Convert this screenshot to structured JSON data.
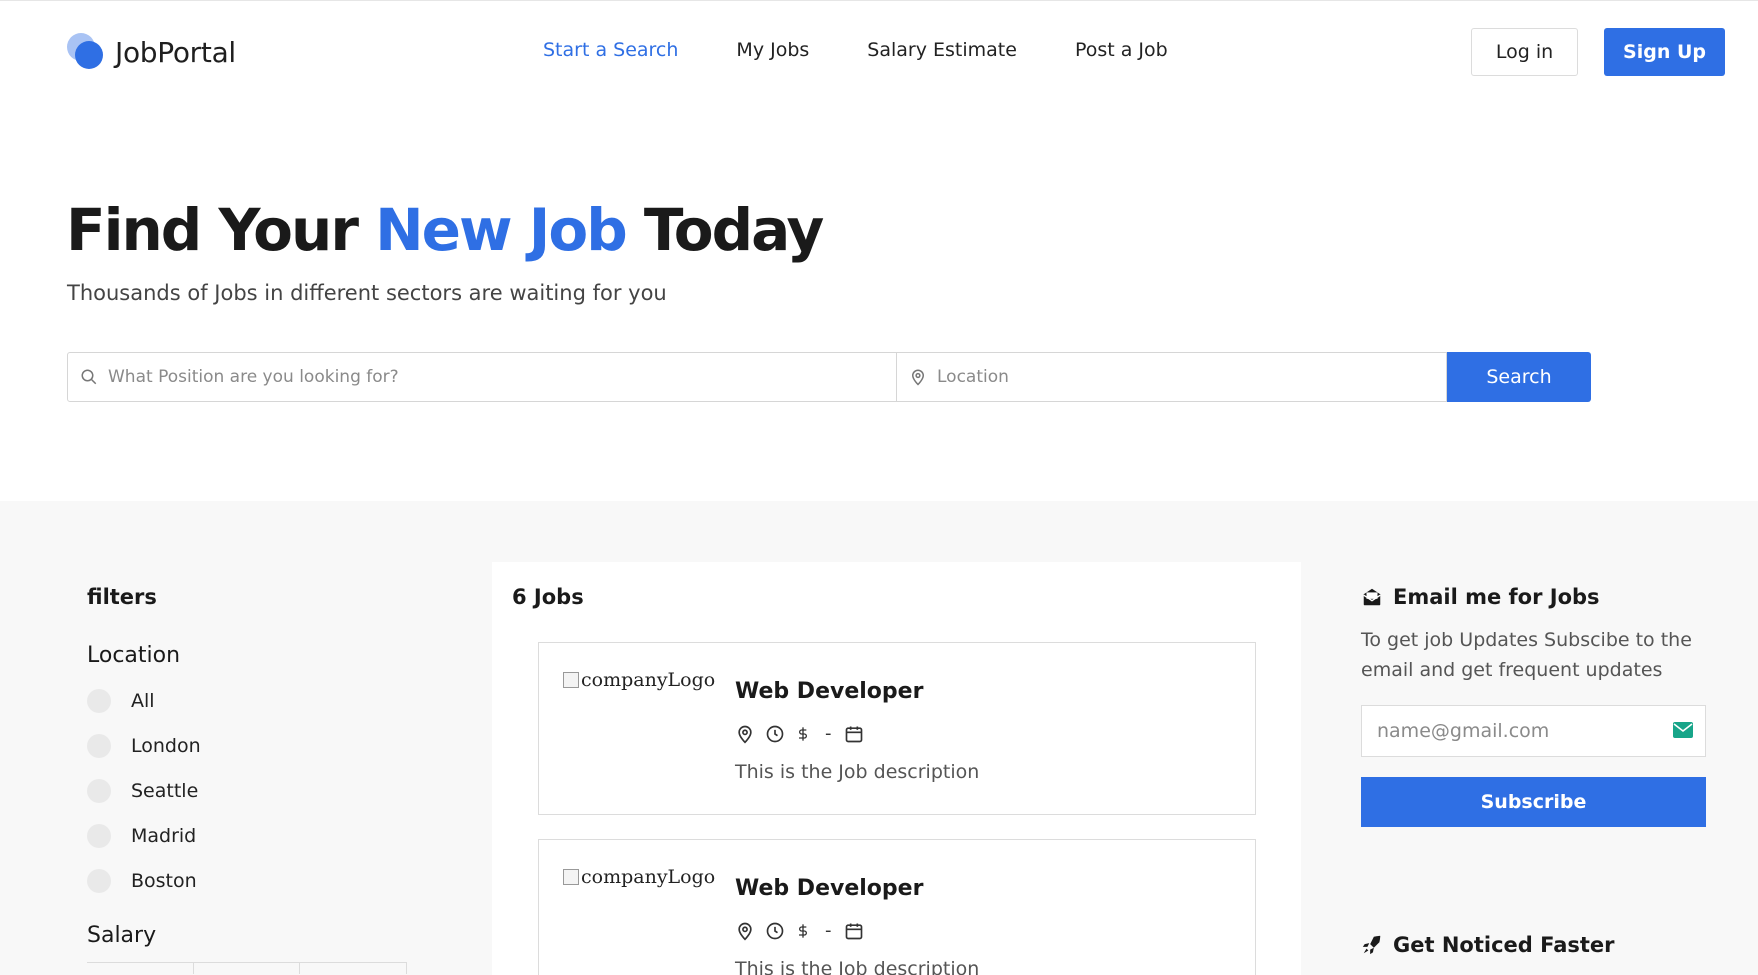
{
  "header": {
    "logo_text": "JobPortal",
    "nav": [
      {
        "label": "Start a Search",
        "active": true
      },
      {
        "label": "My Jobs",
        "active": false
      },
      {
        "label": "Salary Estimate",
        "active": false
      },
      {
        "label": "Post a Job",
        "active": false
      }
    ],
    "login_label": "Log in",
    "signup_label": "Sign Up"
  },
  "hero": {
    "title_part1": "Find Your ",
    "title_accent": "New Job",
    "title_part2": " Today",
    "subtitle": "Thousands of Jobs in different sectors are waiting for you",
    "position_placeholder": "What Position are you looking for?",
    "location_placeholder": "Location",
    "search_label": "Search"
  },
  "filters": {
    "title": "filters",
    "location_title": "Location",
    "locations": [
      "All",
      "London",
      "Seattle",
      "Madrid",
      "Boston"
    ],
    "salary_title": "Salary"
  },
  "jobs": {
    "count_label": "6 Jobs",
    "list": [
      {
        "logo_alt": "companyLogo",
        "title": "Web Developer",
        "dash": "-",
        "description": "This is the Job description"
      },
      {
        "logo_alt": "companyLogo",
        "title": "Web Developer",
        "dash": "-",
        "description": "This is the Job description"
      }
    ]
  },
  "sidebar": {
    "email_title": "Email me for Jobs",
    "email_text": "To get job Updates Subscibe to the email and get frequent updates",
    "email_placeholder": "name@gmail.com",
    "subscribe_label": "Subscribe",
    "noticed_title": "Get Noticed Faster"
  },
  "colors": {
    "accent": "#2f6fe4",
    "section_bg": "#f8f8f8"
  }
}
